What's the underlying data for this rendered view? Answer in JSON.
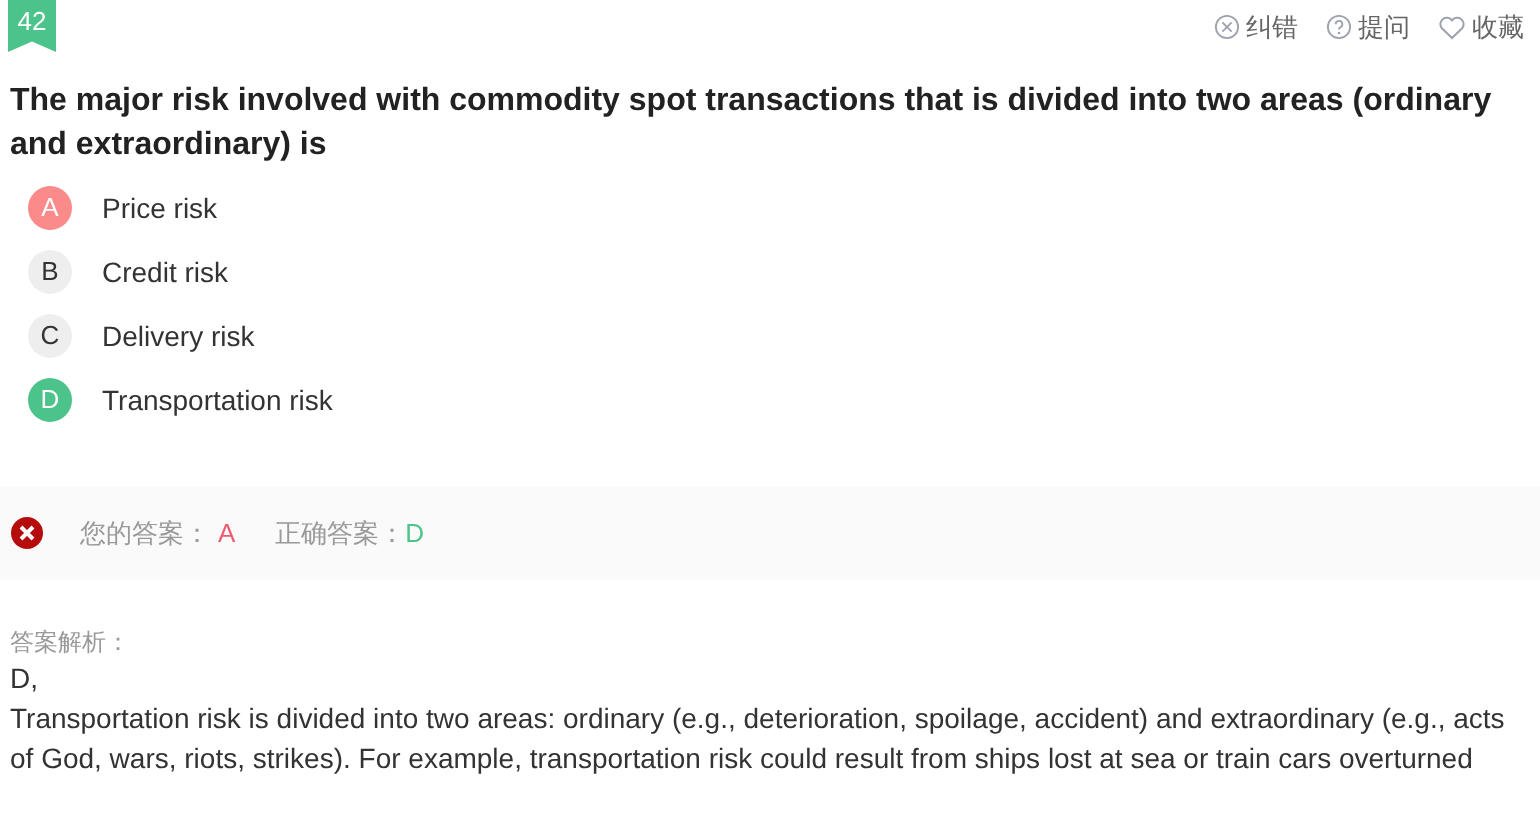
{
  "question_number": "42",
  "actions": [
    {
      "kind": "report",
      "label": "纠错"
    },
    {
      "kind": "ask",
      "label": "提问"
    },
    {
      "kind": "favorite",
      "label": "收藏"
    }
  ],
  "question": "The major risk involved with commodity spot transactions that is divided into two areas (ordinary and extraordinary) is",
  "options": [
    {
      "letter": "A",
      "text": "Price risk",
      "kind": "wrong"
    },
    {
      "letter": "B",
      "text": "Credit risk",
      "kind": "plain"
    },
    {
      "letter": "C",
      "text": "Delivery risk",
      "kind": "plain"
    },
    {
      "letter": "D",
      "text": "Transportation risk",
      "kind": "correct"
    }
  ],
  "result": {
    "correct": false,
    "your_answer_label": "您的答案：",
    "your_answer": "A",
    "correct_answer_label": "正确答案：",
    "correct_answer": "D"
  },
  "explanation": {
    "label": "答案解析：",
    "lines": [
      "D,",
      "Transportation risk is divided into two areas: ordinary (e.g., deterioration, spoilage, accident) and extraordinary (e.g., acts of God, wars, riots, strikes). For example, transportation risk could result from ships lost at sea or train cars overturned"
    ]
  }
}
